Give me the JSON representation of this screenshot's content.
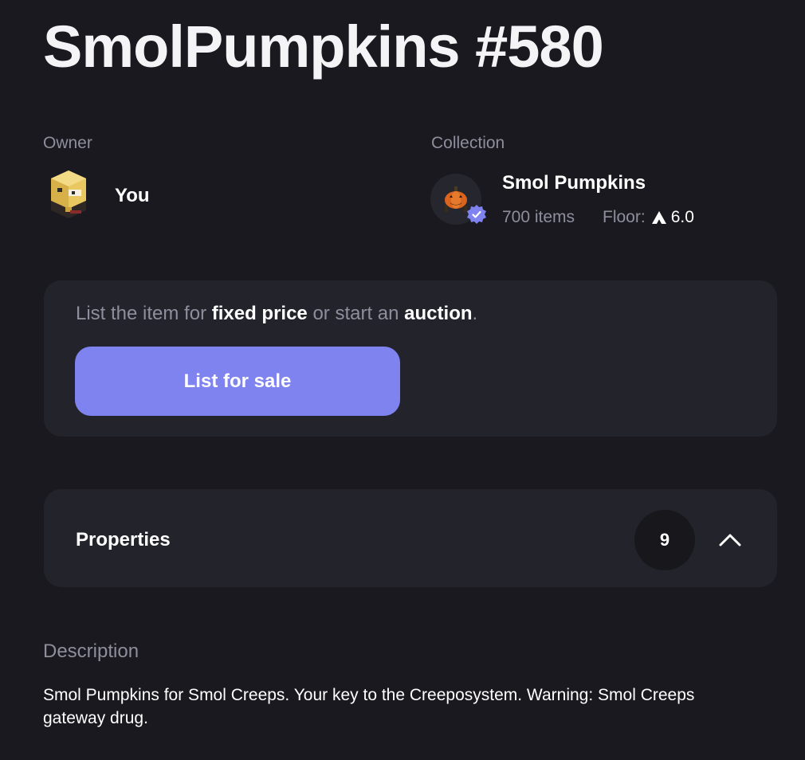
{
  "title": "SmolPumpkins #580",
  "owner": {
    "label": "Owner",
    "name": "You",
    "avatar_icon": "blocky-character-avatar"
  },
  "collection": {
    "label": "Collection",
    "name": "Smol Pumpkins",
    "items": "700 items",
    "floor_label": "Floor:",
    "floor_value": "6.0",
    "currency_icon": "avax-icon",
    "avatar_icon": "pumpkin-avatar",
    "verified_icon": "verified-badge-icon"
  },
  "listing": {
    "text_prefix": "List the item for ",
    "text_fixed": "fixed price",
    "text_middle": " or start an ",
    "text_auction": "auction",
    "text_suffix": ".",
    "button_label": "List for sale"
  },
  "properties": {
    "title": "Properties",
    "count": "9",
    "toggle_icon": "chevron-up-icon"
  },
  "description": {
    "label": "Description",
    "text": "Smol Pumpkins for Smol Creeps. Your key to the Creeposystem. Warning: Smol Creeps gateway drug."
  },
  "colors": {
    "background": "#19191f",
    "card": "#23232b",
    "accent": "#7f83f0",
    "muted_text": "#8e8e9c"
  }
}
